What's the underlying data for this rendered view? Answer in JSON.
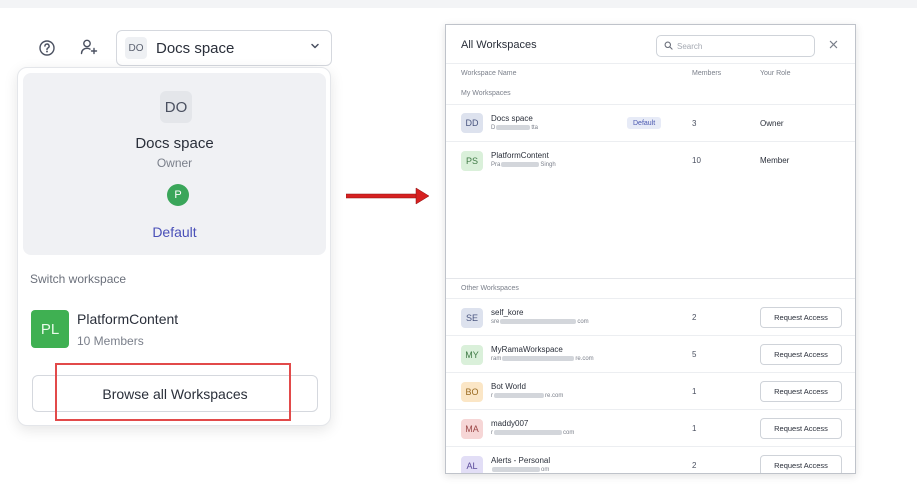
{
  "topbar": {
    "current_workspace_abbr": "DO",
    "current_workspace_name": "Docs space"
  },
  "dropdown": {
    "card": {
      "avatar": "DO",
      "name": "Docs space",
      "role": "Owner",
      "user_initial": "P",
      "default_label": "Default"
    },
    "switch_label": "Switch workspace",
    "switch_item": {
      "avatar": "PL",
      "name": "PlatformContent",
      "members": "10 Members"
    },
    "browse_button": "Browse all Workspaces"
  },
  "modal": {
    "title": "All Workspaces",
    "search_placeholder": "Search",
    "columns": {
      "name": "Workspace Name",
      "members": "Members",
      "role": "Your Role"
    },
    "my_label": "My Workspaces",
    "my_workspaces": [
      {
        "avatar": "DD",
        "name": "Docs space",
        "sub_start": "D",
        "sub_end": "tta",
        "badge": "Default",
        "members": "3",
        "role": "Owner"
      },
      {
        "avatar": "PS",
        "name": "PlatformContent",
        "sub_start": "Pra",
        "sub_end": "Singh",
        "members": "10",
        "role": "Member"
      }
    ],
    "other_label": "Other Workspaces",
    "other_workspaces": [
      {
        "avatar": "SE",
        "name": "self_kore",
        "sub_start": "sre",
        "sub_end": "com",
        "members": "2",
        "action": "Request Access"
      },
      {
        "avatar": "MY",
        "name": "MyRamaWorkspace",
        "sub_start": "ram",
        "sub_end": "re.com",
        "members": "5",
        "action": "Request Access"
      },
      {
        "avatar": "BO",
        "name": "Bot World",
        "sub_start": "r",
        "sub_end": "re.com",
        "members": "1",
        "action": "Request Access"
      },
      {
        "avatar": "MA",
        "name": "maddy007",
        "sub_start": "r",
        "sub_end": "com",
        "members": "1",
        "action": "Request Access"
      },
      {
        "avatar": "AL",
        "name": "Alerts - Personal",
        "sub_start": "",
        "sub_end": "om",
        "members": "2",
        "action": "Request Access"
      }
    ]
  },
  "colors": {
    "accent_link": "#4a50b8",
    "highlight_box": "#e24a4a",
    "arrow": "#d62020",
    "default_badge_bg": "#e7ebf7",
    "avatar_user": "#3aa65a"
  },
  "icons": {
    "help": "help-circle-icon",
    "add_user": "add-user-icon",
    "chevron": "chevron-down-icon",
    "search": "search-icon",
    "close": "close-icon",
    "arrow": "right-arrow-icon"
  }
}
